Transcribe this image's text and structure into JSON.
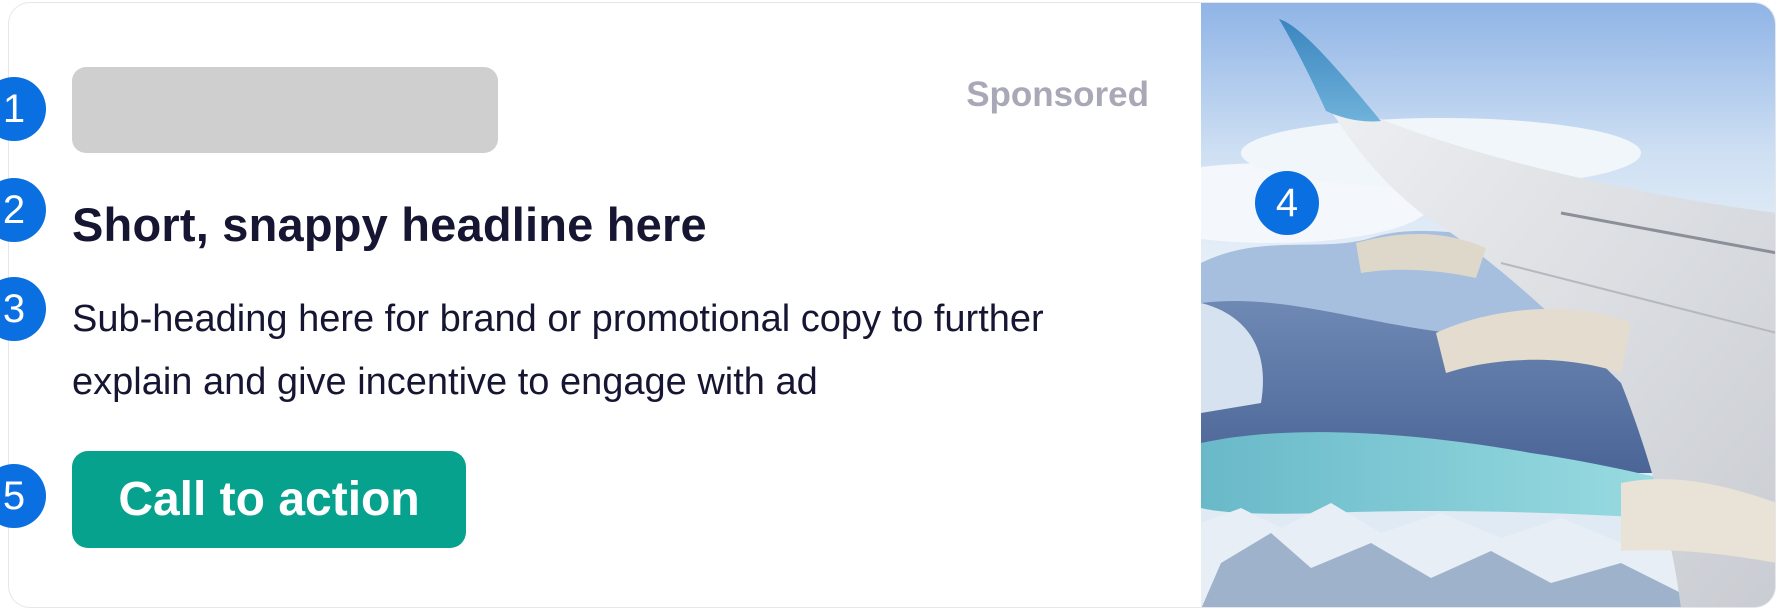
{
  "ad": {
    "sponsored_label": "Sponsored",
    "headline": "Short, snappy headline here",
    "subheading": "Sub-heading here for brand or promotional copy to further explain and give incentive to engage with ad",
    "cta_label": "Call to action",
    "image_description": "airplane-wing-over-mountains-photo"
  },
  "annotations": [
    {
      "label": "1"
    },
    {
      "label": "2"
    },
    {
      "label": "3"
    },
    {
      "label": "4"
    },
    {
      "label": "5"
    }
  ],
  "colors": {
    "cta_background": "#07a28e",
    "badge": "#0a6fe0",
    "headline_text": "#161633",
    "sponsored_text": "#a8a8b6",
    "logo_placeholder": "#cfcfcf"
  }
}
